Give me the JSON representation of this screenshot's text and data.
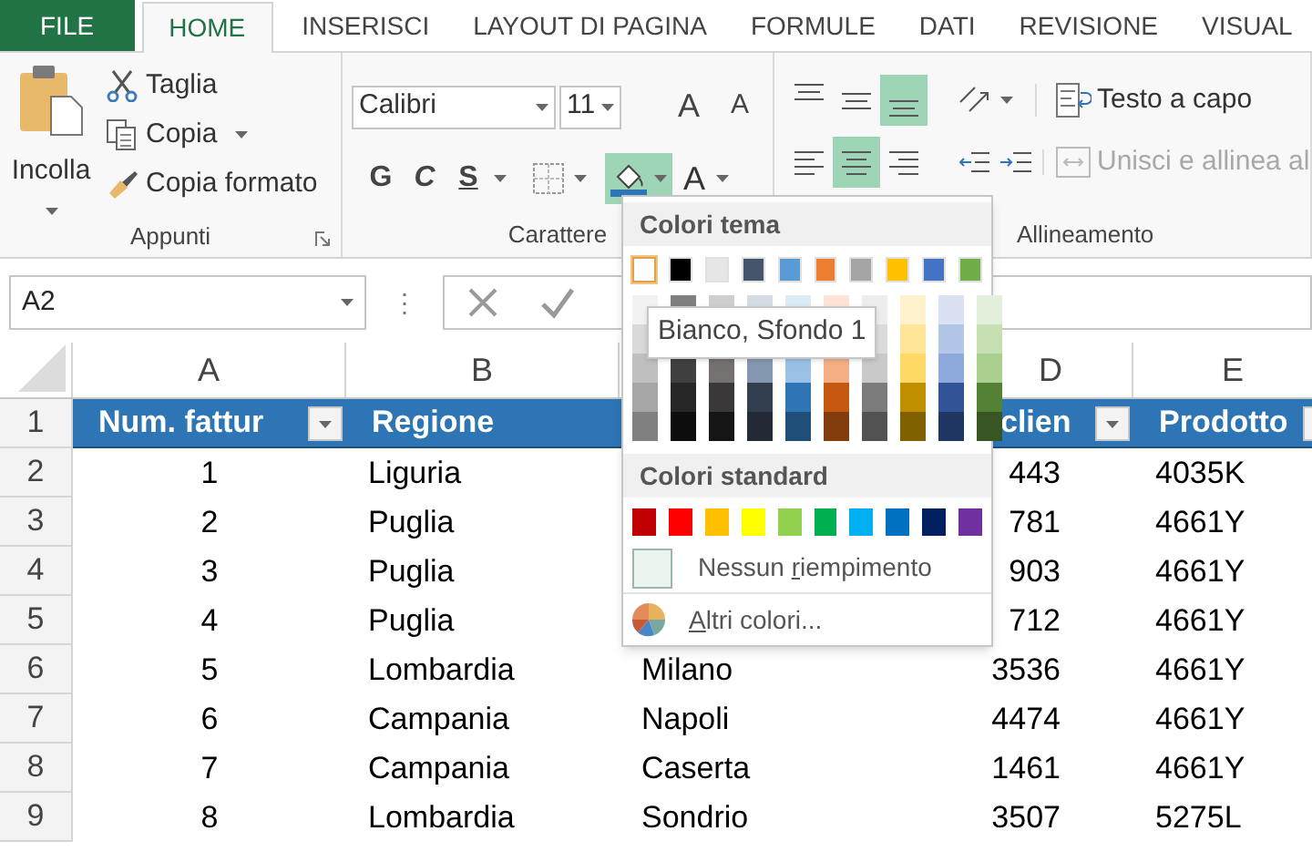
{
  "tabs": [
    {
      "label": "FILE",
      "kind": "file",
      "selected": false
    },
    {
      "label": "HOME",
      "kind": "tab",
      "selected": true
    },
    {
      "label": "INSERISCI",
      "kind": "tab",
      "selected": false
    },
    {
      "label": "LAYOUT DI PAGINA",
      "kind": "tab",
      "selected": false
    },
    {
      "label": "FORMULE",
      "kind": "tab",
      "selected": false
    },
    {
      "label": "DATI",
      "kind": "tab",
      "selected": false
    },
    {
      "label": "REVISIONE",
      "kind": "tab",
      "selected": false
    },
    {
      "label": "VISUAL",
      "kind": "tab",
      "selected": false
    }
  ],
  "clipboard": {
    "paste": "Incolla",
    "cut": "Taglia",
    "copy": "Copia",
    "format_painter": "Copia formato",
    "label": "Appunti"
  },
  "font": {
    "family": "Calibri",
    "size": "11",
    "grow": "A",
    "shrink": "A",
    "bold": "G",
    "italic": "C",
    "underline": "S",
    "fill_on": true,
    "font_color": "A",
    "label": "Carattere"
  },
  "alignment": {
    "vertical": [
      {
        "kind": "top",
        "on": false
      },
      {
        "kind": "middle",
        "on": false
      },
      {
        "kind": "bottom",
        "on": true
      }
    ],
    "horizontal": [
      {
        "kind": "left",
        "on": false
      },
      {
        "kind": "center",
        "on": true
      },
      {
        "kind": "right",
        "on": false
      }
    ],
    "wrap": "Testo a capo",
    "merge": "Unisci e allinea al",
    "merge_disabled": true,
    "label": "Allineamento"
  },
  "formula_bar": {
    "name_box": "A2",
    "separator": "⋮"
  },
  "grid": {
    "columns": {
      "a": "A",
      "b": "B",
      "d": "D",
      "e": "E"
    },
    "rows": [
      {
        "num": "1",
        "kind": "header",
        "a": "Num. fattur",
        "b": "Regione",
        "d": "clien",
        "e": "Prodotto"
      },
      {
        "num": "2",
        "kind": "data",
        "a": "1",
        "b": "Liguria",
        "d": "443",
        "e": "4035K"
      },
      {
        "num": "3",
        "kind": "data",
        "a": "2",
        "b": "Puglia",
        "d": "781",
        "e": "4661Y"
      },
      {
        "num": "4",
        "kind": "data",
        "a": "3",
        "b": "Puglia",
        "d": "903",
        "e": "4661Y"
      },
      {
        "num": "5",
        "kind": "data",
        "a": "4",
        "b": "Puglia",
        "d": "712",
        "e": "4661Y"
      },
      {
        "num": "6",
        "kind": "data",
        "a": "5",
        "b": "Lombardia",
        "c": "Milano",
        "d": "3536",
        "e": "4661Y"
      },
      {
        "num": "7",
        "kind": "data",
        "a": "6",
        "b": "Campania",
        "c": "Napoli",
        "d": "4474",
        "e": "4661Y"
      },
      {
        "num": "8",
        "kind": "data",
        "a": "7",
        "b": "Campania",
        "c": "Caserta",
        "d": "1461",
        "e": "4661Y"
      },
      {
        "num": "9",
        "kind": "data",
        "a": "8",
        "b": "Lombardia",
        "c": "Sondrio",
        "d": "3507",
        "e": "5275L"
      }
    ]
  },
  "popup": {
    "theme_title": "Colori tema",
    "theme": [
      {
        "color": "#ffffff",
        "selected": true,
        "shades": [
          {
            "color": "#f2f2f2"
          },
          {
            "color": "#d9d9d9"
          },
          {
            "color": "#bfbfbf"
          },
          {
            "color": "#a6a6a6"
          },
          {
            "color": "#808080"
          }
        ]
      },
      {
        "color": "#000000",
        "selected": false,
        "shades": [
          {
            "color": "#808080"
          },
          {
            "color": "#404040"
          },
          {
            "color": "#262626"
          },
          {
            "color": "#0d0d0d"
          }
        ]
      },
      {
        "color": "#e7e6e6",
        "selected": false,
        "shades": [
          {
            "color": "#d0cece"
          },
          {
            "color": "#757171"
          },
          {
            "color": "#3a3838"
          },
          {
            "color": "#171616"
          }
        ]
      },
      {
        "color": "#44546a",
        "selected": false,
        "shades": [
          {
            "color": "#d6dce4"
          },
          {
            "color": "#8497b0"
          },
          {
            "color": "#333f4f"
          },
          {
            "color": "#222b35"
          }
        ]
      },
      {
        "color": "#5b9bd5",
        "selected": false,
        "shades": [
          {
            "color": "#ddebf7"
          },
          {
            "color": "#9bc2e6"
          },
          {
            "color": "#2f75b5"
          },
          {
            "color": "#1f4e78"
          }
        ]
      },
      {
        "color": "#ed7d31",
        "selected": false,
        "shades": [
          {
            "color": "#fce4d6"
          },
          {
            "color": "#f4b084"
          },
          {
            "color": "#c65911"
          },
          {
            "color": "#833c0c"
          }
        ]
      },
      {
        "color": "#a5a5a5",
        "selected": false,
        "shades": [
          {
            "color": "#ededed"
          },
          {
            "color": "#dbdbdb"
          },
          {
            "color": "#c9c9c9"
          },
          {
            "color": "#7b7b7b"
          },
          {
            "color": "#525252"
          }
        ]
      },
      {
        "color": "#ffc000",
        "selected": false,
        "shades": [
          {
            "color": "#fff2cc"
          },
          {
            "color": "#ffe699"
          },
          {
            "color": "#ffd966"
          },
          {
            "color": "#bf8f00"
          },
          {
            "color": "#806000"
          }
        ]
      },
      {
        "color": "#4472c4",
        "selected": false,
        "shades": [
          {
            "color": "#d9e1f2"
          },
          {
            "color": "#b4c6e7"
          },
          {
            "color": "#8ea9db"
          },
          {
            "color": "#305496"
          },
          {
            "color": "#203764"
          }
        ]
      },
      {
        "color": "#70ad47",
        "selected": false,
        "shades": [
          {
            "color": "#e2efda"
          },
          {
            "color": "#c6e0b4"
          },
          {
            "color": "#a9d08e"
          },
          {
            "color": "#548235"
          },
          {
            "color": "#375623"
          }
        ]
      }
    ],
    "standard_title": "Colori standard",
    "standard": [
      {
        "color": "#c00000"
      },
      {
        "color": "#ff0000"
      },
      {
        "color": "#ffc000"
      },
      {
        "color": "#ffff00"
      },
      {
        "color": "#92d050"
      },
      {
        "color": "#00b050"
      },
      {
        "color": "#00b0f0"
      },
      {
        "color": "#0070c0"
      },
      {
        "color": "#002060"
      },
      {
        "color": "#7030a0"
      }
    ],
    "no_fill": "Nessun riempimento",
    "more_colors": "Altri colori...",
    "tooltip": "Bianco, Sfondo 1"
  }
}
